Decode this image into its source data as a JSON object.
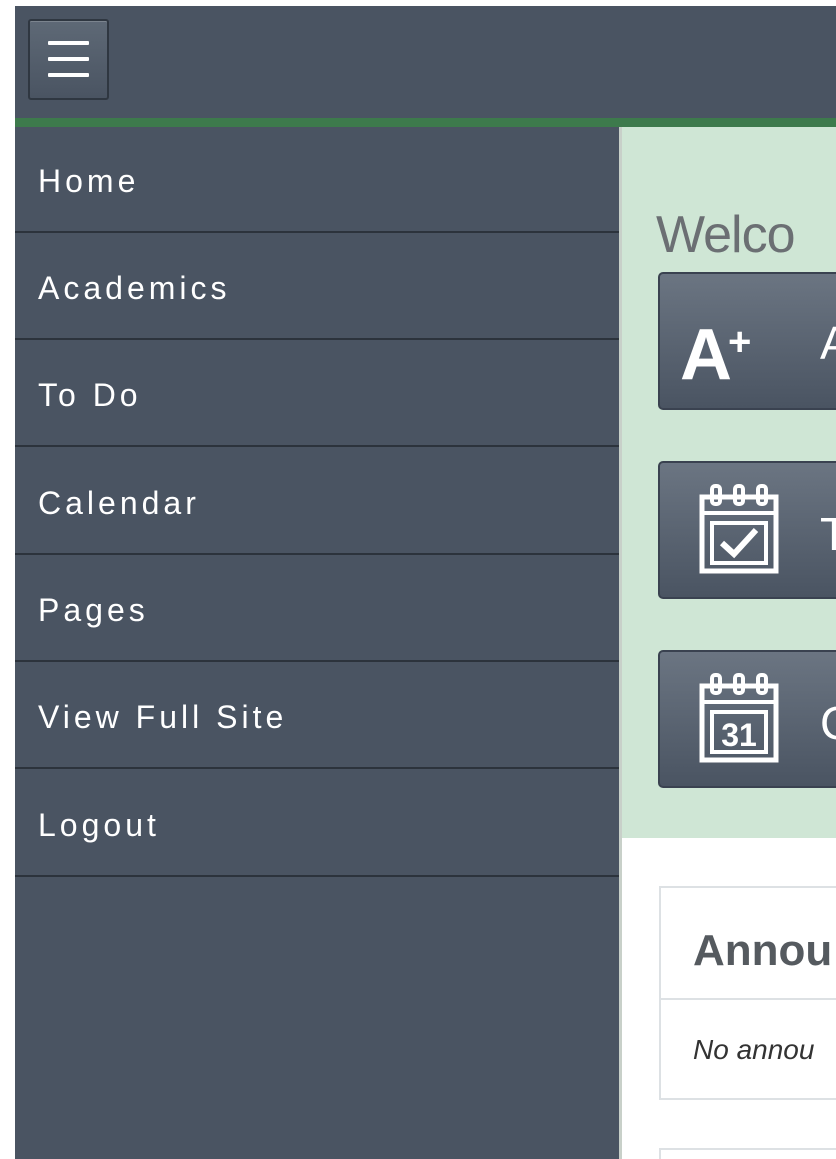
{
  "header": {
    "menu_icon": "hamburger-menu-icon"
  },
  "sidebar": {
    "items": [
      {
        "label": "Home"
      },
      {
        "label": "Academics"
      },
      {
        "label": "To Do"
      },
      {
        "label": "Calendar"
      },
      {
        "label": "Pages"
      },
      {
        "label": "View Full Site"
      },
      {
        "label": "Logout"
      }
    ]
  },
  "main": {
    "welcome_title": "Welco",
    "quick_buttons": [
      {
        "icon": "a-plus-icon",
        "icon_text": "A",
        "icon_sup": "+",
        "label": "A"
      },
      {
        "icon": "calendar-check-icon",
        "label": "T"
      },
      {
        "icon": "calendar-31-icon",
        "icon_text": "31",
        "label": "C"
      }
    ],
    "announcements": {
      "title": "Annou",
      "empty_text": "No annou"
    }
  },
  "colors": {
    "nav_bg": "#4a5462",
    "accent_green": "#3d7a4c",
    "welcome_bg": "#cfe6d5"
  }
}
